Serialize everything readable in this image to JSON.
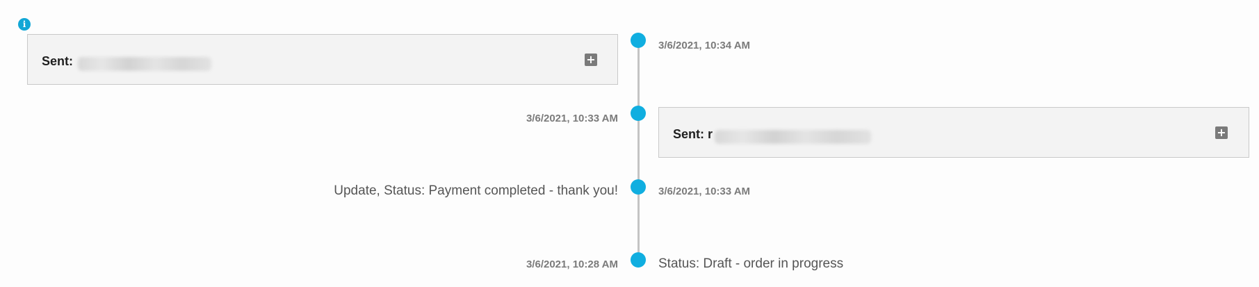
{
  "info_icon": "info-icon",
  "accent_color": "#10aee0",
  "timeline": [
    {
      "timestamp": "3/6/2021, 10:34 AM",
      "content_type": "card",
      "label": "Sent:",
      "icon": "plus-square-icon"
    },
    {
      "timestamp": "3/6/2021, 10:33 AM",
      "content_type": "card",
      "label": "Sent: r",
      "icon": "plus-square-icon"
    },
    {
      "timestamp": "3/6/2021, 10:33 AM",
      "content_type": "text",
      "text": "Update, Status: Payment completed - thank you!"
    },
    {
      "timestamp": "3/6/2021, 10:28 AM",
      "content_type": "text",
      "text": "Status: Draft - order in progress"
    }
  ]
}
